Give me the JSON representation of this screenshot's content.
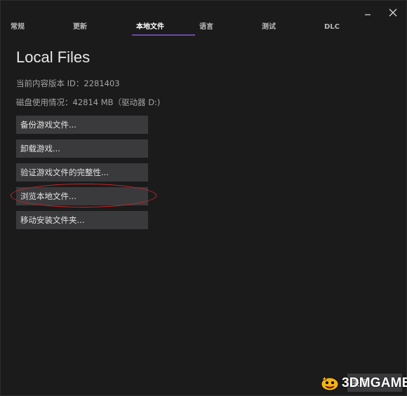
{
  "window": {
    "minimize_icon": "minimize-icon",
    "close_icon": "close-x-icon"
  },
  "tabs": [
    {
      "label": "常规",
      "active": false
    },
    {
      "label": "更新",
      "active": false
    },
    {
      "label": "本地文件",
      "active": true
    },
    {
      "label": "语言",
      "active": false
    },
    {
      "label": "测试",
      "active": false
    },
    {
      "label": "DLC",
      "active": false
    }
  ],
  "main": {
    "title": "Local Files",
    "content_version": "当前内容版本 ID：2281403",
    "disk_usage": "磁盘使用情况：42814 MB（驱动器 D:)",
    "buttons": [
      {
        "label": "备份游戏文件..."
      },
      {
        "label": "卸载游戏..."
      },
      {
        "label": "验证游戏文件的完整性..."
      },
      {
        "label": "浏览本地文件...",
        "highlighted": true
      },
      {
        "label": "移动安装文件夹..."
      }
    ]
  },
  "footer": {
    "close_label": "关闭"
  },
  "watermark": {
    "text": "3DMGAME"
  },
  "colors": {
    "background": "#1b1b1c",
    "button": "#3a3a3c",
    "active_tab_underline": "#6a48a8",
    "highlight_ellipse": "#c82828"
  }
}
